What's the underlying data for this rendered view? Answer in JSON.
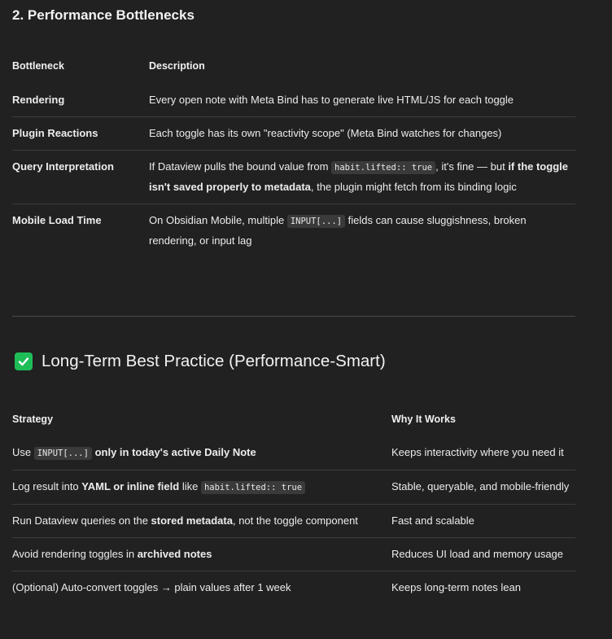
{
  "section1": {
    "heading": "2. Performance Bottlenecks",
    "columns": [
      "Bottleneck",
      "Description"
    ],
    "rows": [
      {
        "bottleneck": "Rendering",
        "desc": [
          {
            "t": "Every open note with Meta Bind has to generate live HTML/JS for each toggle"
          }
        ]
      },
      {
        "bottleneck": "Plugin Reactions",
        "desc": [
          {
            "t": "Each toggle has its own \"reactivity scope\" (Meta Bind watches for changes)"
          }
        ]
      },
      {
        "bottleneck": "Query Interpretation",
        "desc": [
          {
            "t": "If Dataview pulls the bound value from "
          },
          {
            "t": "habit.lifted:: true",
            "code": true
          },
          {
            "t": ", it's fine — but "
          },
          {
            "t": "if the toggle isn't saved properly to metadata",
            "bold": true
          },
          {
            "t": ", the plugin might fetch from its binding logic"
          }
        ]
      },
      {
        "bottleneck": "Mobile Load Time",
        "desc": [
          {
            "t": "On Obsidian Mobile, multiple "
          },
          {
            "t": "INPUT[...]",
            "code": true
          },
          {
            "t": " fields can cause sluggishness, broken rendering, or input lag"
          }
        ]
      }
    ]
  },
  "section2": {
    "heading": "Long-Term Best Practice (Performance-Smart)",
    "heading_icon": "green-check-icon",
    "accent_color": "#1fbd58",
    "columns": [
      "Strategy",
      "Why It Works"
    ],
    "rows": [
      {
        "strategy": [
          {
            "t": "Use "
          },
          {
            "t": "INPUT[...]",
            "code": true
          },
          {
            "t": " "
          },
          {
            "t": "only in today's active Daily Note",
            "bold": true
          }
        ],
        "why": "Keeps interactivity where you need it"
      },
      {
        "strategy": [
          {
            "t": "Log result into "
          },
          {
            "t": "YAML or inline field",
            "bold": true
          },
          {
            "t": " like "
          },
          {
            "t": "habit.lifted:: true",
            "code": true
          }
        ],
        "why": "Stable, queryable, and mobile-friendly"
      },
      {
        "strategy": [
          {
            "t": "Run Dataview queries on the "
          },
          {
            "t": "stored metadata",
            "bold": true
          },
          {
            "t": ", not the toggle component"
          }
        ],
        "why": "Fast and scalable"
      },
      {
        "strategy": [
          {
            "t": "Avoid rendering toggles in "
          },
          {
            "t": "archived notes",
            "bold": true
          }
        ],
        "why": "Reduces UI load and memory usage"
      },
      {
        "strategy": [
          {
            "t": "(Optional) Auto-convert toggles → plain values after 1 week"
          }
        ],
        "why": "Keeps long-term notes lean"
      }
    ]
  }
}
